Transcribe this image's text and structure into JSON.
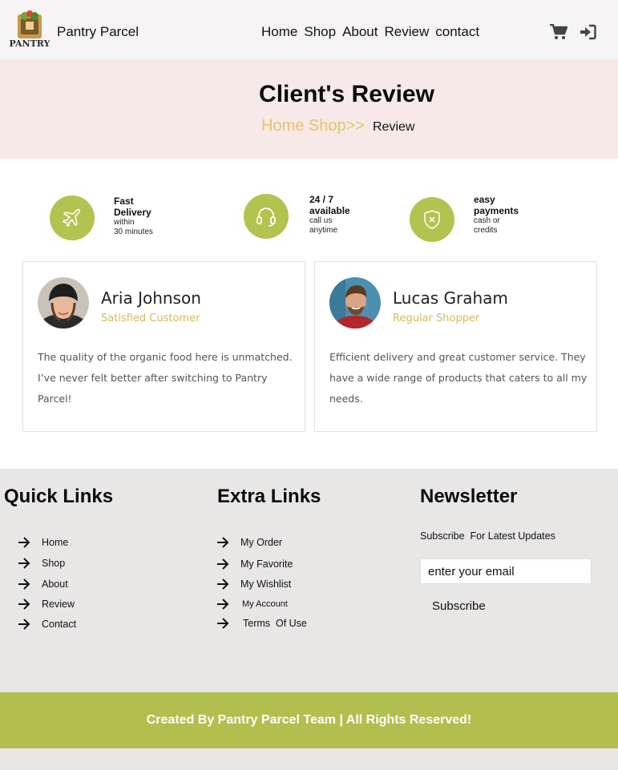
{
  "header": {
    "brand": "Pantry Parcel",
    "logo_text": "PANTRY",
    "nav": [
      "Home",
      "Shop",
      "About",
      "Review",
      "contact"
    ]
  },
  "banner": {
    "title": "Client's Review",
    "crumb_links": "Home Shop>>",
    "crumb_current": "Review"
  },
  "features": [
    {
      "title": "Fast Delivery",
      "sub": [
        "within",
        "30 minutes"
      ],
      "icon": "plane-icon"
    },
    {
      "title": "24 / 7 available",
      "sub": [
        "call us",
        "anytime"
      ],
      "icon": "headset-icon"
    },
    {
      "title": "easy payments",
      "sub": [
        "cash or",
        "credits"
      ],
      "icon": "shield-icon"
    }
  ],
  "reviews": [
    {
      "name": "Aria Johnson",
      "role": "Satisfied Customer",
      "text": "The quality of the organic food here is unmatched. I’ve never felt better after switching to Pantry Parcel!"
    },
    {
      "name": "Lucas Graham",
      "role": "Regular Shopper",
      "text": "Efficient delivery and great customer service. They have a wide range of products that caters to all my needs."
    }
  ],
  "footer": {
    "quick_title": "Quick Links",
    "quick_links": [
      "Home",
      "Shop",
      "About",
      "Review",
      "Contact"
    ],
    "extra_title": "Extra Links",
    "extra_links": [
      "My Order",
      "My Favorite",
      "My Wishlist",
      "My Account",
      "Terms  Of Use"
    ],
    "newsletter_title": "Newsletter",
    "newsletter_sub": "Subscribe  For Latest Updates",
    "email_placeholder": "enter your email",
    "subscribe_label": "Subscribe"
  },
  "copyright": "Created By Pantry Parcel Team | All Rights Reserved!",
  "colors": {
    "accent": "#b2bf4f",
    "gold": "#e6c36a",
    "banner": "#f8e9e9",
    "footer": "#e9e6e6"
  }
}
